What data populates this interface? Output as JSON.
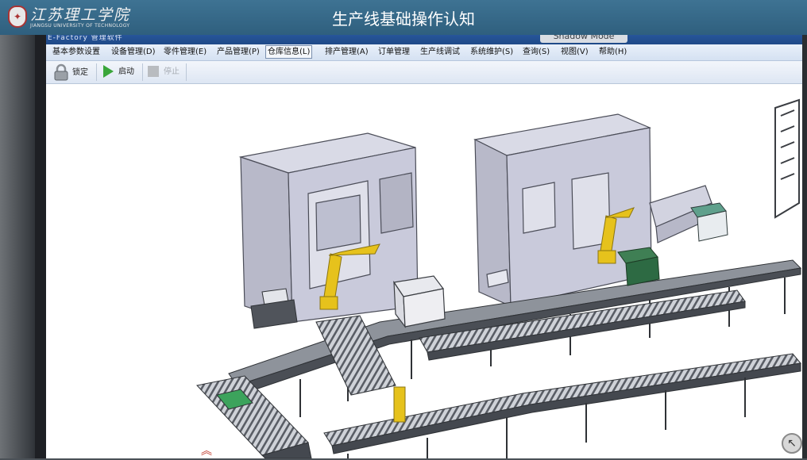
{
  "header": {
    "logo_cn": "江苏理工学院",
    "logo_en": "JIANGSU UNIVERSITY OF TECHNOLOGY",
    "title": "生产线基础操作认知"
  },
  "app": {
    "title": "E-Factory 管理软件",
    "shadow_mode_label": "Shadow Mode",
    "menu": [
      "基本参数设置",
      "设备管理(D)",
      "零件管理(E)",
      "产品管理(P)",
      "仓库信息(L)",
      "排产管理(A)",
      "订单管理",
      "生产线调试",
      "系统维护(S)",
      "查询(S)",
      "视图(V)",
      "帮助(H)"
    ],
    "active_menu_index": 4,
    "toolbar": {
      "lock_label": "锁定",
      "start_label": "启动",
      "stop_label": "停止"
    }
  },
  "icons": {
    "lock": "padlock-icon",
    "start": "play-icon",
    "stop": "stop-icon",
    "collapse": "double-chevron-up-icon",
    "corner": "arrow-up-left-icon"
  },
  "colors": {
    "banner": "#336a8c",
    "app_title_bar": "#2352a0",
    "robot_arm": "#e6c21c",
    "machine_gray": "#cfd0de",
    "conveyor_frame": "#3a3d42",
    "green_belt": "#3ca35c"
  }
}
